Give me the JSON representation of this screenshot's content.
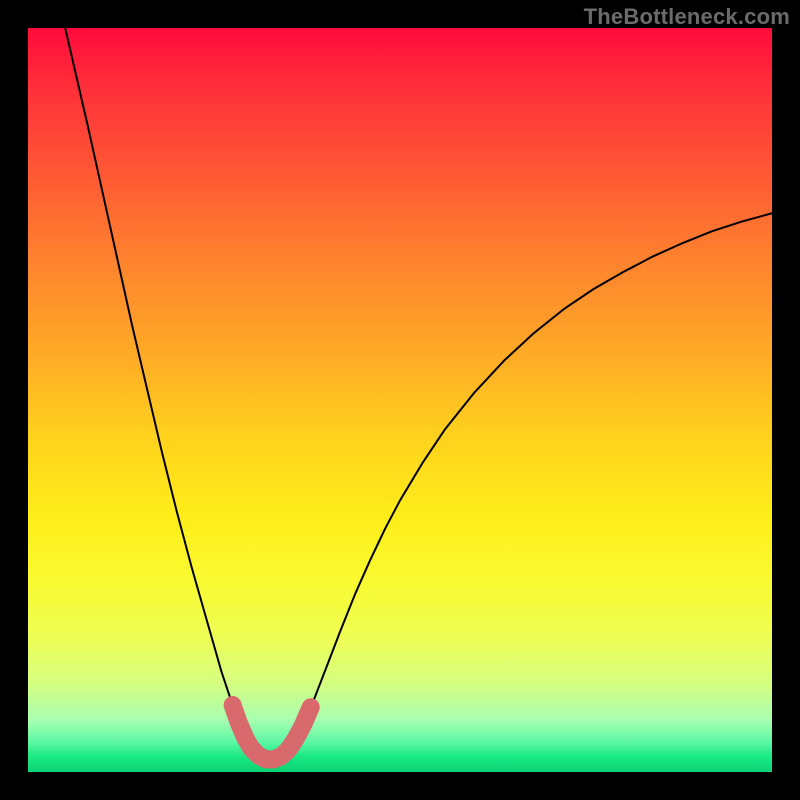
{
  "watermark": "TheBottleneck.com",
  "chart_data": {
    "type": "line",
    "title": "",
    "xlabel": "",
    "ylabel": "",
    "xlim": [
      0,
      100
    ],
    "ylim": [
      0,
      100
    ],
    "grid": false,
    "series": [
      {
        "name": "curve",
        "color": "#000000",
        "points": [
          {
            "x": 5.0,
            "y": 100.0
          },
          {
            "x": 6.5,
            "y": 93.5
          },
          {
            "x": 8.0,
            "y": 87.0
          },
          {
            "x": 10.0,
            "y": 78.0
          },
          {
            "x": 12.0,
            "y": 69.0
          },
          {
            "x": 14.0,
            "y": 60.0
          },
          {
            "x": 16.0,
            "y": 51.5
          },
          {
            "x": 18.0,
            "y": 43.0
          },
          {
            "x": 20.0,
            "y": 35.0
          },
          {
            "x": 22.0,
            "y": 27.5
          },
          {
            "x": 24.0,
            "y": 20.5
          },
          {
            "x": 25.0,
            "y": 17.0
          },
          {
            "x": 26.0,
            "y": 13.5
          },
          {
            "x": 27.0,
            "y": 10.5
          },
          {
            "x": 28.0,
            "y": 7.7
          },
          {
            "x": 29.0,
            "y": 5.3
          },
          {
            "x": 30.0,
            "y": 3.4
          },
          {
            "x": 31.0,
            "y": 2.0
          },
          {
            "x": 32.0,
            "y": 1.3
          },
          {
            "x": 33.0,
            "y": 1.2
          },
          {
            "x": 34.0,
            "y": 1.6
          },
          {
            "x": 35.0,
            "y": 2.6
          },
          {
            "x": 36.0,
            "y": 4.2
          },
          {
            "x": 37.0,
            "y": 6.2
          },
          {
            "x": 38.0,
            "y": 8.6
          },
          {
            "x": 39.0,
            "y": 11.2
          },
          {
            "x": 40.0,
            "y": 13.8
          },
          {
            "x": 42.0,
            "y": 19.0
          },
          {
            "x": 44.0,
            "y": 24.0
          },
          {
            "x": 46.0,
            "y": 28.5
          },
          {
            "x": 48.0,
            "y": 32.7
          },
          {
            "x": 50.0,
            "y": 36.5
          },
          {
            "x": 53.0,
            "y": 41.5
          },
          {
            "x": 56.0,
            "y": 46.0
          },
          {
            "x": 60.0,
            "y": 51.0
          },
          {
            "x": 64.0,
            "y": 55.3
          },
          {
            "x": 68.0,
            "y": 59.0
          },
          {
            "x": 72.0,
            "y": 62.2
          },
          {
            "x": 76.0,
            "y": 64.9
          },
          {
            "x": 80.0,
            "y": 67.2
          },
          {
            "x": 84.0,
            "y": 69.3
          },
          {
            "x": 88.0,
            "y": 71.1
          },
          {
            "x": 92.0,
            "y": 72.7
          },
          {
            "x": 96.0,
            "y": 74.0
          },
          {
            "x": 100.0,
            "y": 75.1
          }
        ]
      },
      {
        "name": "highlight",
        "color": "#d86a6d",
        "points": [
          {
            "x": 27.5,
            "y": 9.0
          },
          {
            "x": 28.3,
            "y": 6.7
          },
          {
            "x": 29.2,
            "y": 4.6
          },
          {
            "x": 30.0,
            "y": 3.2
          },
          {
            "x": 31.0,
            "y": 2.2
          },
          {
            "x": 32.0,
            "y": 1.7
          },
          {
            "x": 33.0,
            "y": 1.7
          },
          {
            "x": 34.0,
            "y": 2.1
          },
          {
            "x": 35.0,
            "y": 3.0
          },
          {
            "x": 36.0,
            "y": 4.5
          },
          {
            "x": 37.0,
            "y": 6.4
          },
          {
            "x": 38.0,
            "y": 8.7
          }
        ]
      }
    ]
  }
}
